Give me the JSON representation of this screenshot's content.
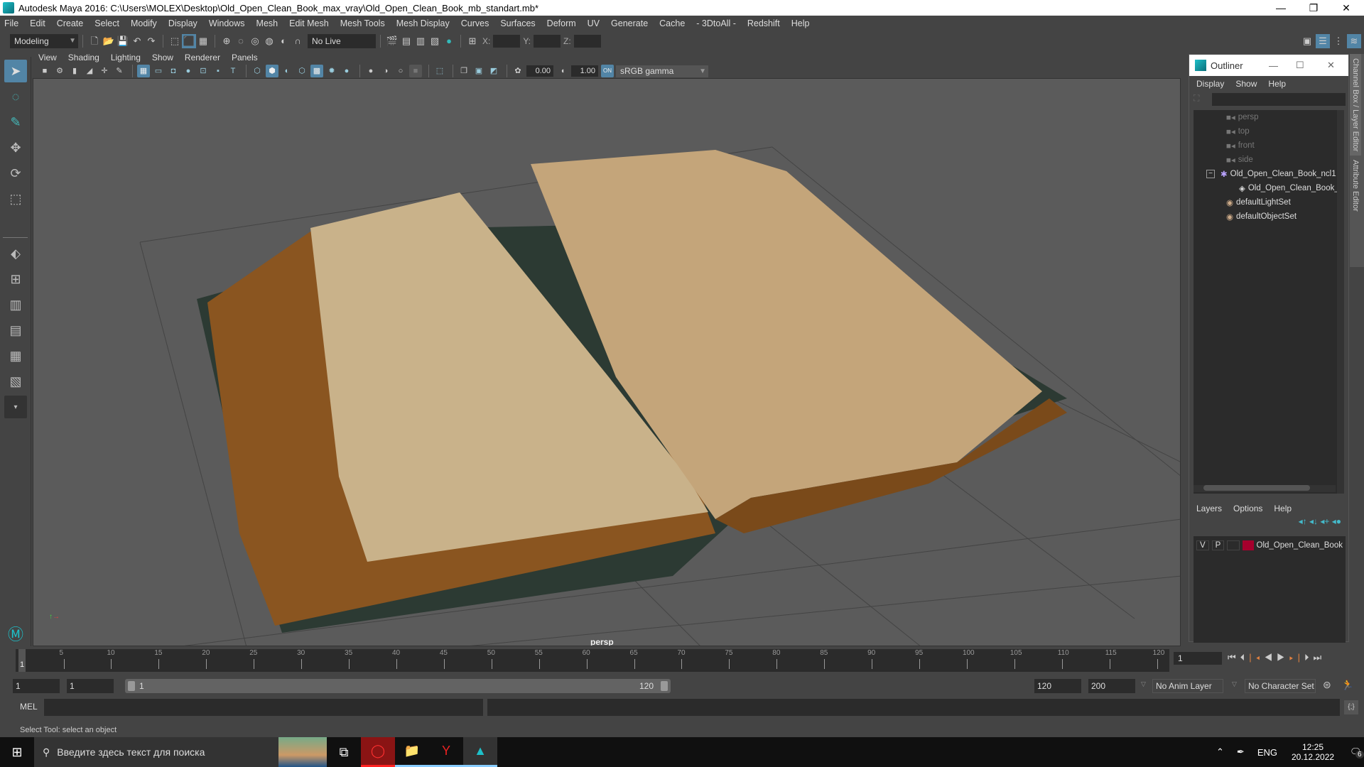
{
  "window": {
    "title": "Autodesk Maya 2016: C:\\Users\\MOLEX\\Desktop\\Old_Open_Clean_Book_max_vray\\Old_Open_Clean_Book_mb_standart.mb*",
    "minimize": "—",
    "restore": "❐",
    "close": "✕"
  },
  "menubar": [
    "File",
    "Edit",
    "Create",
    "Select",
    "Modify",
    "Display",
    "Windows",
    "Mesh",
    "Edit Mesh",
    "Mesh Tools",
    "Mesh Display",
    "Curves",
    "Surfaces",
    "Deform",
    "UV",
    "Generate",
    "Cache",
    "- 3DtoAll -",
    "Redshift",
    "Help"
  ],
  "shelf": {
    "mode": "Modeling",
    "live_surface": "No Live Surface",
    "x_label": "X:",
    "y_label": "Y:",
    "z_label": "Z:"
  },
  "panel": {
    "menus": [
      "View",
      "Shading",
      "Lighting",
      "Show",
      "Renderer",
      "Panels"
    ],
    "exposure": "0.00",
    "gamma": "1.00",
    "color_space": "sRGB gamma",
    "camera_label": "persp"
  },
  "outliner": {
    "title": "Outliner",
    "menus": [
      "Display",
      "Show",
      "Help"
    ],
    "items": [
      {
        "label": "persp",
        "icon": "camera-icon",
        "dim": true
      },
      {
        "label": "top",
        "icon": "camera-icon",
        "dim": true
      },
      {
        "label": "front",
        "icon": "camera-icon",
        "dim": true
      },
      {
        "label": "side",
        "icon": "camera-icon",
        "dim": true
      },
      {
        "label": "Old_Open_Clean_Book_ncl1",
        "icon": "group-icon",
        "dim": false
      },
      {
        "label": "Old_Open_Clean_Book_",
        "icon": "mesh-icon",
        "dim": false
      },
      {
        "label": "defaultLightSet",
        "icon": "set-icon",
        "dim": false
      },
      {
        "label": "defaultObjectSet",
        "icon": "set-icon",
        "dim": false
      }
    ]
  },
  "layers": {
    "menus": [
      "Layers",
      "Options",
      "Help"
    ],
    "rows": [
      {
        "v": "V",
        "p": "P",
        "name": "Old_Open_Clean_Book",
        "color": "#a5002d"
      }
    ]
  },
  "side_tabs": [
    "Channel Box / Layer Editor",
    "Attribute Editor"
  ],
  "timeline": {
    "ticks": [
      "5",
      "10",
      "15",
      "20",
      "25",
      "30",
      "35",
      "40",
      "45",
      "50",
      "55",
      "60",
      "65",
      "70",
      "75",
      "80",
      "85",
      "90",
      "95",
      "100",
      "105",
      "110",
      "115",
      "120"
    ],
    "current_marker": "1",
    "current_frame": "1"
  },
  "range": {
    "start": "1",
    "playback_start": "1",
    "slider_start": "1",
    "slider_end": "120",
    "playback_end": "120",
    "end": "200",
    "anim_layer": "No Anim Layer",
    "character_set": "No Character Set"
  },
  "command": {
    "label": "MEL"
  },
  "help_line": "Select Tool: select an object",
  "taskbar": {
    "search_placeholder": "Введите здесь текст для поиска",
    "lang": "ENG",
    "time": "12:25",
    "date": "20.12.2022",
    "notifications": "6"
  },
  "colors": {
    "accent": "#5285a6",
    "layer": "#a5002d"
  }
}
